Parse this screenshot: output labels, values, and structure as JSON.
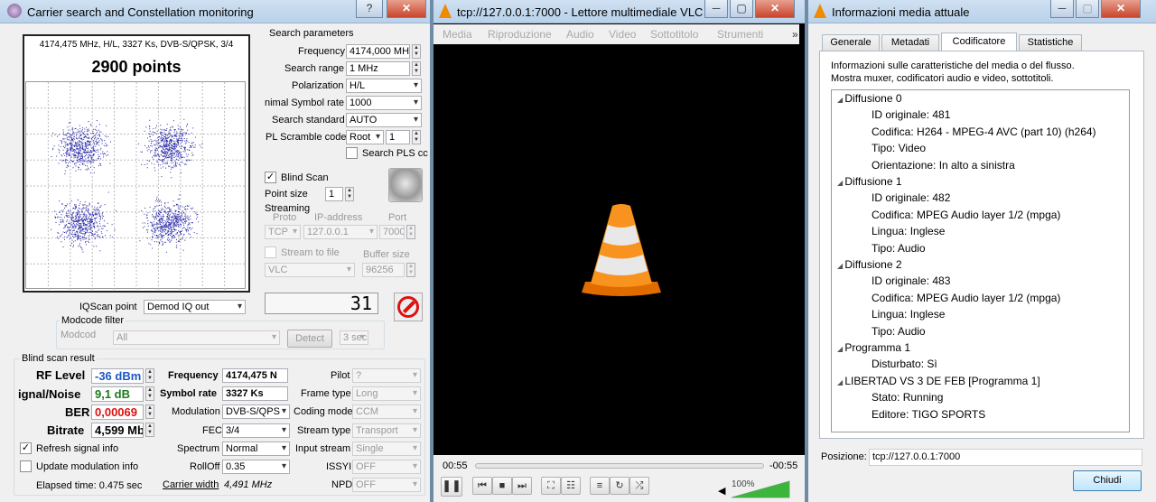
{
  "left": {
    "title": "Carrier search and Constellation monitoring",
    "help_btn": "?",
    "close_btn": "✕",
    "info_line": "4174,475 MHz, H/L, 3327 Ks, DVB-S/QPSK, 3/4",
    "points": "2900 points",
    "search_params": {
      "title": "Search parameters",
      "frequency_label": "Frequency",
      "frequency": "4174,000 MHz",
      "range_label": "Search range",
      "range": "1 MHz",
      "polarization_label": "Polarization",
      "polarization": "H/L",
      "min_sr_label": "nimal Symbol rate",
      "min_sr": "1000",
      "standard_label": "Search standard",
      "standard": "AUTO",
      "pls_label": "PL Scramble code",
      "pls_mode": "Root",
      "pls_value": "1",
      "search_pls_label": "Search PLS cc"
    },
    "blind_scan_label": "Blind Scan",
    "blind_scan_checked": true,
    "point_size_label": "Point size",
    "point_size": "1",
    "streaming": {
      "title": "Streaming",
      "proto_h": "Proto",
      "ip_h": "IP-address",
      "port_h": "Port",
      "proto": "TCP",
      "ip": "127.0.0.1",
      "port": "7000",
      "stream_to_file": "Stream to file",
      "buffer_label": "Buffer size",
      "player": "VLC",
      "buffer": "96256"
    },
    "iqscan_label": "IQScan point",
    "iqscan": "Demod IQ out",
    "counter": "31",
    "modcode": {
      "title": "Modcode filter",
      "label": "Modcod",
      "value": "All",
      "detect": "Detect",
      "secs": "3 sec"
    },
    "result": {
      "title": "Blind scan result",
      "rf_label": "RF Level",
      "rf": "-36 dBm",
      "sn_label": "ignal/Noise",
      "sn": "9,1 dB",
      "ber_label": "BER",
      "ber": "0,00069",
      "bitrate_label": "Bitrate",
      "bitrate": "4,599 Mb",
      "freq_label": "Frequency",
      "freq": "4174,475 N",
      "sr_label": "Symbol rate",
      "sr": "3327 Ks",
      "mod_label": "Modulation",
      "mod": "DVB-S/QPS",
      "fec_label": "FEC",
      "fec": "3/4",
      "spectrum_label": "Spectrum",
      "spectrum": "Normal",
      "rolloff_label": "RollOff",
      "rolloff": "0.35",
      "carrier_label": "Carrier width",
      "carrier": "4,491 MHz",
      "pilot_label": "Pilot",
      "pilot": "?",
      "frame_label": "Frame type",
      "frame": "Long",
      "coding_label": "Coding mode",
      "coding": "CCM",
      "stream_label": "Stream type",
      "stream": "Transport",
      "input_label": "Input stream",
      "input": "Single",
      "issyi_label": "ISSYI",
      "issyi": "OFF",
      "npd_label": "NPD",
      "npd": "OFF"
    },
    "refresh_label": "Refresh signal info",
    "refresh_checked": true,
    "update_label": "Update modulation info",
    "update_checked": false,
    "elapsed": "Elapsed time: 0.475 sec"
  },
  "vlc": {
    "title": "tcp://127.0.0.1:7000 - Lettore multimediale VLC",
    "menu": [
      "Media",
      "Riproduzione",
      "Audio",
      "Video",
      "Sottotitolo",
      "Strumenti"
    ],
    "more": "»",
    "time_left": "00:55",
    "time_right": "-00:55",
    "volume": "100%",
    "volume_level": 1.0,
    "progress": 0
  },
  "info": {
    "title": "Informazioni media attuale",
    "tabs": [
      "Generale",
      "Metadati",
      "Codificatore",
      "Statistiche"
    ],
    "active_tab": "Codificatore",
    "desc1": "Informazioni sulle caratteristiche del media o del flusso.",
    "desc2": "Mostra muxer, codificatori audio e video, sottotitoli.",
    "tree": [
      {
        "t": "Diffusione 0",
        "lvl": 0
      },
      {
        "t": "ID originale: 481",
        "lvl": 1
      },
      {
        "t": "Codifica: H264 - MPEG-4 AVC (part 10) (h264)",
        "lvl": 1
      },
      {
        "t": "Tipo: Video",
        "lvl": 1
      },
      {
        "t": "Orientazione: In alto a sinistra",
        "lvl": 1
      },
      {
        "t": "Diffusione 1",
        "lvl": 0
      },
      {
        "t": "ID originale: 482",
        "lvl": 1
      },
      {
        "t": "Codifica: MPEG Audio layer 1/2 (mpga)",
        "lvl": 1
      },
      {
        "t": "Lingua: Inglese",
        "lvl": 1
      },
      {
        "t": "Tipo: Audio",
        "lvl": 1
      },
      {
        "t": "Diffusione 2",
        "lvl": 0
      },
      {
        "t": "ID originale: 483",
        "lvl": 1
      },
      {
        "t": "Codifica: MPEG Audio layer 1/2 (mpga)",
        "lvl": 1
      },
      {
        "t": "Lingua: Inglese",
        "lvl": 1
      },
      {
        "t": "Tipo: Audio",
        "lvl": 1
      },
      {
        "t": "Programma 1",
        "lvl": 0
      },
      {
        "t": "Disturbato: Sì",
        "lvl": 1
      },
      {
        "t": "LIBERTAD VS 3 DE FEB [Programma 1]",
        "lvl": 0
      },
      {
        "t": "Stato: Running",
        "lvl": 1
      },
      {
        "t": "Editore: TIGO SPORTS",
        "lvl": 1
      }
    ],
    "position_label": "Posizione:",
    "position": "tcp://127.0.0.1:7000",
    "close": "Chiudi"
  }
}
